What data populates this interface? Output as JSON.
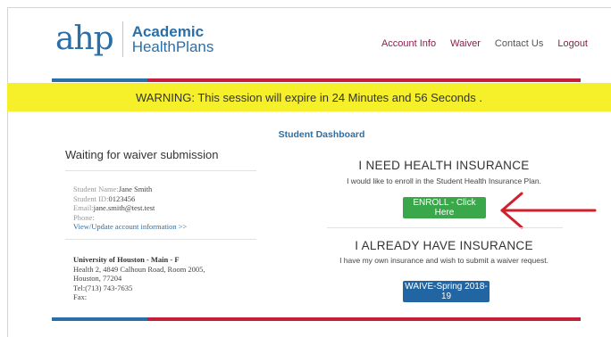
{
  "logo": {
    "mark": "ahp",
    "line1": "Academic",
    "line2": "HealthPlans"
  },
  "nav": [
    "Account Info",
    "Waiver",
    "Contact Us",
    "Logout"
  ],
  "warning": "WARNING: This session will expire in 24 Minutes and 56 Seconds .",
  "dashboard_title": "Student Dashboard",
  "status_title": "Waiting for waiver submission",
  "student": {
    "name_label": "Student Name:",
    "name": "Jane Smith",
    "id_label": "Student ID:",
    "id": "0123456",
    "email_label": "Email:",
    "email": "jane.smith@test.test",
    "phone_label": "Phone:",
    "phone": "",
    "update_link": "View/Update account information >>"
  },
  "school": {
    "name": "University of Houston - Main - F",
    "address1": "Health 2, 4849 Calhoun Road, Room 2005,",
    "address2": "Houston, 77204",
    "tel": "Tel:(713) 743-7635",
    "fax": "Fax:"
  },
  "need": {
    "heading": "I NEED HEALTH INSURANCE",
    "sub": "I would like to enroll in the Student Health Insurance Plan.",
    "button": "ENROLL - Click Here"
  },
  "have": {
    "heading": "I ALREADY HAVE INSURANCE",
    "sub": "I have my own insurance and wish to submit a waiver request.",
    "button": "WAIVE-Spring 2018-19"
  },
  "colors": {
    "brand_blue": "#2a6fa8",
    "brand_red": "#c41e3a",
    "warning_yellow": "#f5f02a",
    "enroll_green": "#3aa84a",
    "waive_blue": "#2166a3",
    "arrow_red": "#d0202e"
  }
}
